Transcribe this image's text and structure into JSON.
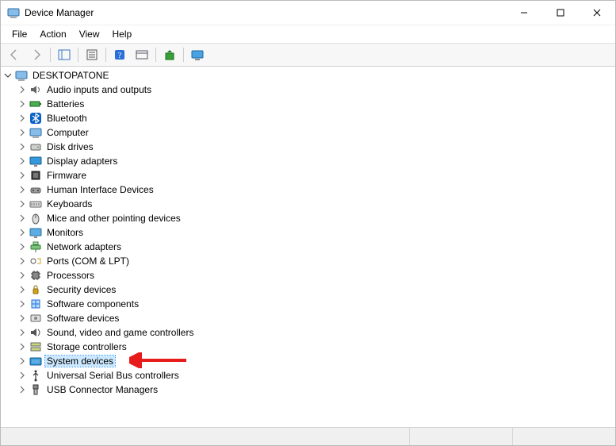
{
  "window": {
    "title": "Device Manager"
  },
  "menus": {
    "file": "File",
    "action": "Action",
    "view": "View",
    "help": "Help"
  },
  "toolbar": {
    "back": "Back",
    "forward": "Forward",
    "show_hide_tree": "Show/Hide Console Tree",
    "properties": "Properties",
    "help": "Help",
    "refresh": "Scan for hardware changes",
    "update": "Update driver",
    "monitor": "Devices"
  },
  "tree": {
    "root": {
      "label": "DESKTOPATONE",
      "icon": "computer-icon",
      "expanded": true
    },
    "children": [
      {
        "label": "Audio inputs and outputs",
        "icon": "speaker-icon"
      },
      {
        "label": "Batteries",
        "icon": "battery-icon"
      },
      {
        "label": "Bluetooth",
        "icon": "bluetooth-icon"
      },
      {
        "label": "Computer",
        "icon": "computer-icon"
      },
      {
        "label": "Disk drives",
        "icon": "disk-icon"
      },
      {
        "label": "Display adapters",
        "icon": "display-icon"
      },
      {
        "label": "Firmware",
        "icon": "firmware-icon"
      },
      {
        "label": "Human Interface Devices",
        "icon": "hid-icon"
      },
      {
        "label": "Keyboards",
        "icon": "keyboard-icon"
      },
      {
        "label": "Mice and other pointing devices",
        "icon": "mouse-icon"
      },
      {
        "label": "Monitors",
        "icon": "monitor-icon"
      },
      {
        "label": "Network adapters",
        "icon": "network-icon"
      },
      {
        "label": "Ports (COM & LPT)",
        "icon": "port-icon"
      },
      {
        "label": "Processors",
        "icon": "cpu-icon"
      },
      {
        "label": "Security devices",
        "icon": "security-icon"
      },
      {
        "label": "Software components",
        "icon": "software-component-icon"
      },
      {
        "label": "Software devices",
        "icon": "software-device-icon"
      },
      {
        "label": "Sound, video and game controllers",
        "icon": "sound-icon"
      },
      {
        "label": "Storage controllers",
        "icon": "storage-icon"
      },
      {
        "label": "System devices",
        "icon": "system-icon",
        "selected": true
      },
      {
        "label": "Universal Serial Bus controllers",
        "icon": "usb-icon"
      },
      {
        "label": "USB Connector Managers",
        "icon": "usb-connector-icon"
      }
    ]
  },
  "annotation": {
    "arrow_color": "#e81b1b"
  }
}
